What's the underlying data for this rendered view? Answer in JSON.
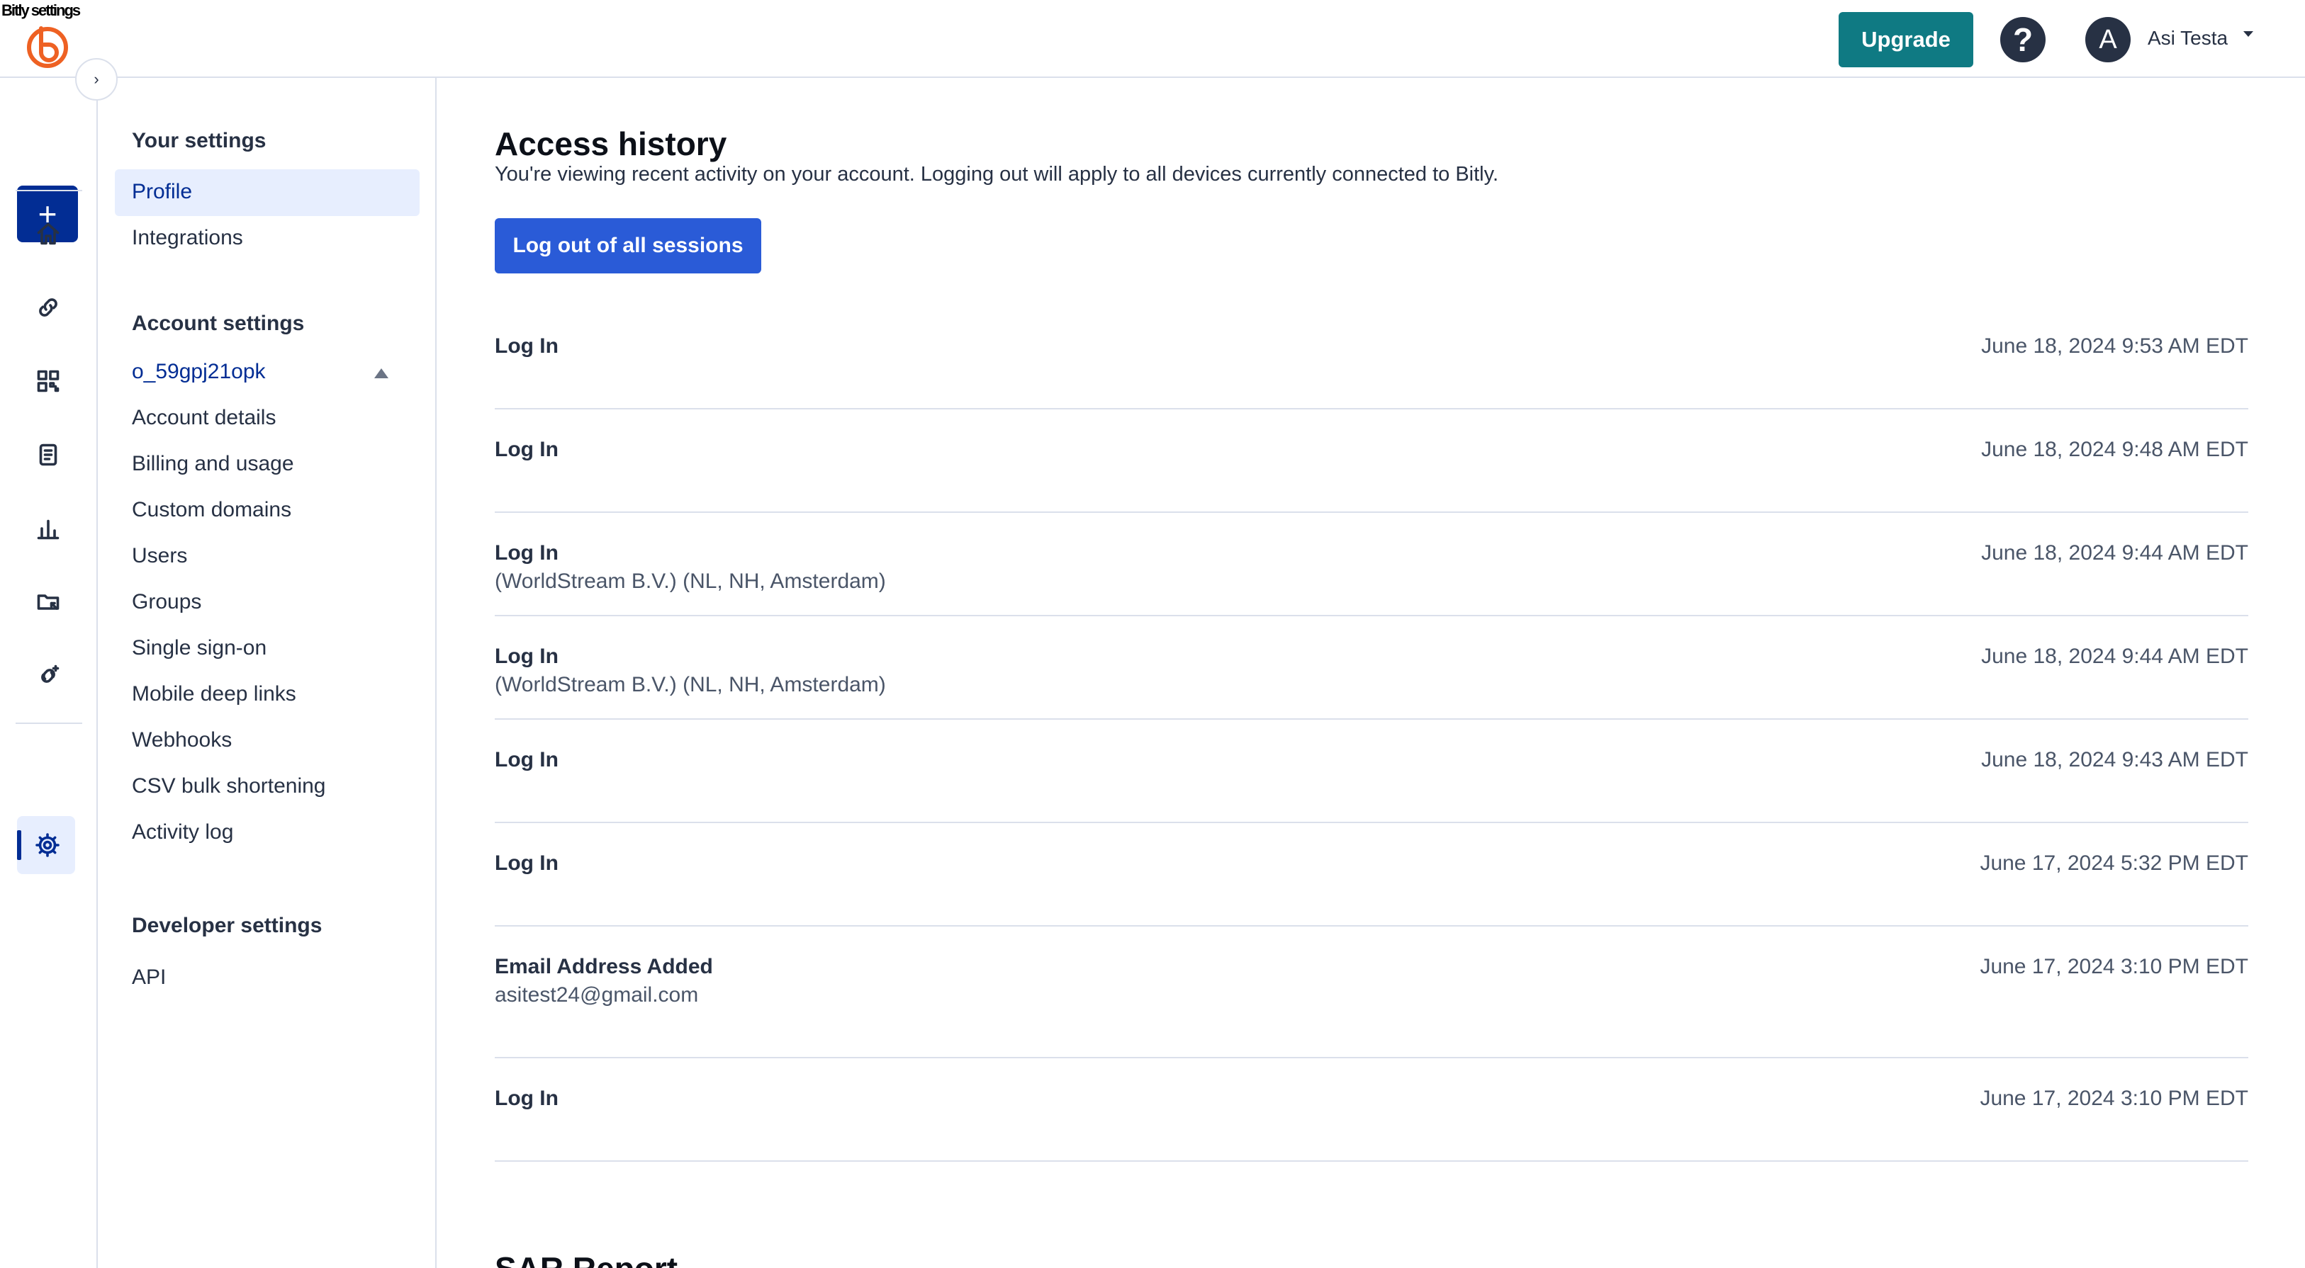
{
  "top_bar": {
    "overlay_text": "Bitly settings",
    "upgrade_label": "Upgrade",
    "help_glyph": "?",
    "avatar_initial": "A",
    "user_name": "Asi Testa",
    "logo_icon": "bitly-logo-icon"
  },
  "rail": {
    "collapse_glyph": "›",
    "create_glyph": "+",
    "icons": [
      "home-icon",
      "link-icon",
      "qr-code-icon",
      "pages-icon",
      "analytics-icon",
      "campaigns-icon",
      "custom-links-icon",
      "settings-icon"
    ],
    "active_icon": "settings-icon"
  },
  "settings_nav": {
    "your_settings_heading": "Your settings",
    "your_settings_items": [
      "Profile",
      "Integrations"
    ],
    "account_settings_heading": "Account settings",
    "org_name": "o_59gpj21opk",
    "account_items": [
      "Account details",
      "Billing and usage",
      "Custom domains",
      "Users",
      "Groups",
      "Single sign-on",
      "Mobile deep links",
      "Webhooks",
      "CSV bulk shortening",
      "Activity log"
    ],
    "developer_settings_heading": "Developer settings",
    "developer_items": [
      "API"
    ]
  },
  "main": {
    "title": "Access history",
    "description": "You're viewing recent activity on your account. Logging out will apply to all devices currently connected to Bitly.",
    "logout_button": "Log out of all sessions",
    "history": [
      {
        "event": "Log In",
        "detail": "",
        "date": "June 18, 2024 9:53 AM EDT"
      },
      {
        "event": "Log In",
        "detail": "",
        "date": "June 18, 2024 9:48 AM EDT"
      },
      {
        "event": "Log In",
        "detail": "(WorldStream B.V.) (NL, NH, Amsterdam)",
        "date": "June 18, 2024 9:44 AM EDT"
      },
      {
        "event": "Log In",
        "detail": "(WorldStream B.V.) (NL, NH, Amsterdam)",
        "date": "June 18, 2024 9:44 AM EDT"
      },
      {
        "event": "Log In",
        "detail": "",
        "date": "June 18, 2024 9:43 AM EDT"
      },
      {
        "event": "Log In",
        "detail": "",
        "date": "June 17, 2024 5:32 PM EDT"
      },
      {
        "event": "Email Address Added",
        "detail": "asitest24@gmail.com",
        "date": "June 17, 2024 3:10 PM EDT"
      },
      {
        "event": "Log In",
        "detail": "",
        "date": "June 17, 2024 3:10 PM EDT"
      }
    ],
    "next_section_title": "SAR Report"
  },
  "colors": {
    "upgrade": "#0f7a83",
    "create": "#022d94",
    "primary_button": "#2a5bd7",
    "active_bg": "#e7eefe",
    "logo": "#ee6123"
  }
}
